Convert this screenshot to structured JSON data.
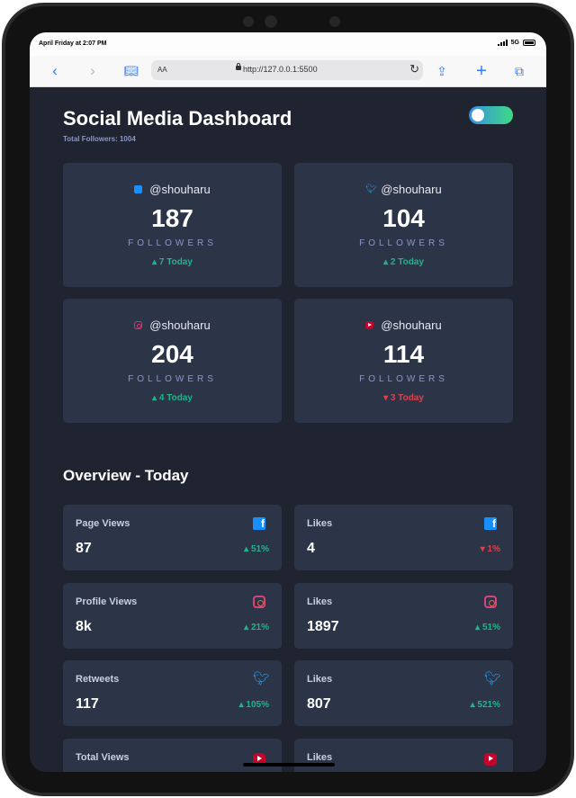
{
  "status": {
    "time": "April Friday at 2:07 PM",
    "network": "5G"
  },
  "browser": {
    "url": "http://127.0.0.1:5500",
    "reader_label": "AA"
  },
  "header": {
    "title": "Social Media Dashboard",
    "total_followers": "Total Followers: 1004",
    "dark_mode": true
  },
  "followers_label": "FOLLOWERS",
  "cards": [
    {
      "platform": "facebook",
      "icon": "facebook-icon",
      "handle": "@shouharu",
      "count": "187",
      "change": "7 Today",
      "trend": "up",
      "color": "#178fff"
    },
    {
      "platform": "twitter",
      "icon": "twitter-icon",
      "handle": "@shouharu",
      "count": "104",
      "change": "2 Today",
      "trend": "up",
      "color": "#1da0f2"
    },
    {
      "platform": "instagram",
      "icon": "instagram-icon",
      "handle": "@shouharu",
      "count": "204",
      "change": "4 Today",
      "trend": "up",
      "color": "#e1306c"
    },
    {
      "platform": "youtube",
      "icon": "youtube-icon",
      "handle": "@shouharu",
      "count": "114",
      "change": "3 Today",
      "trend": "down",
      "color": "#c4032b"
    }
  ],
  "overview": {
    "title": "Overview - Today",
    "items": [
      {
        "label": "Page Views",
        "value": "87",
        "change": "51%",
        "trend": "up",
        "icon": "facebook-icon"
      },
      {
        "label": "Likes",
        "value": "4",
        "change": "1%",
        "trend": "down",
        "icon": "facebook-icon"
      },
      {
        "label": "Profile Views",
        "value": "8k",
        "change": "21%",
        "trend": "up",
        "icon": "instagram-icon"
      },
      {
        "label": "Likes",
        "value": "1897",
        "change": "51%",
        "trend": "up",
        "icon": "instagram-icon"
      },
      {
        "label": "Retweets",
        "value": "117",
        "change": "105%",
        "trend": "up",
        "icon": "twitter-icon"
      },
      {
        "label": "Likes",
        "value": "807",
        "change": "521%",
        "trend": "up",
        "icon": "twitter-icon"
      },
      {
        "label": "Total Views",
        "value": "",
        "change": "",
        "trend": "up",
        "icon": "youtube-icon"
      },
      {
        "label": "Likes",
        "value": "",
        "change": "",
        "trend": "up",
        "icon": "youtube-icon"
      }
    ]
  },
  "colors": {
    "up": "#1eb589",
    "down": "#dc414c",
    "card_bg": "#2c3548",
    "page_bg": "#1f2430"
  }
}
